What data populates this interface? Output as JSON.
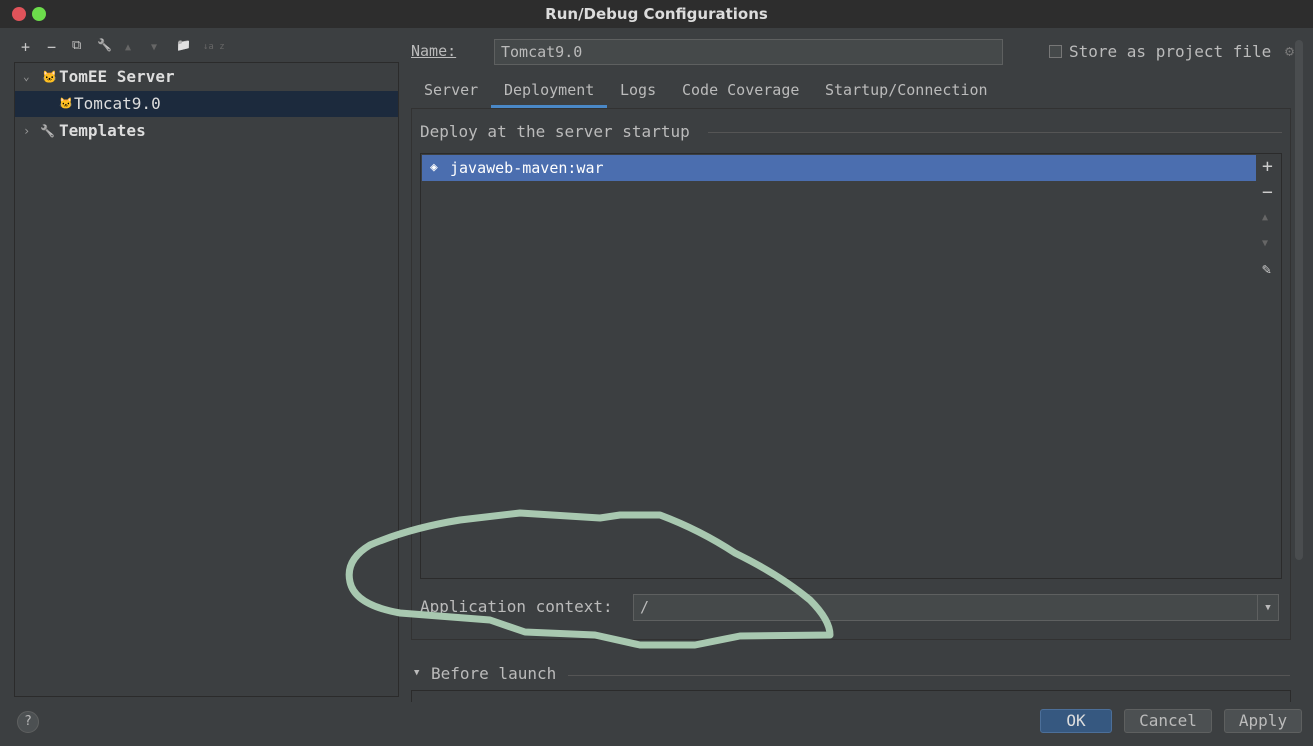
{
  "window": {
    "title": "Run/Debug Configurations"
  },
  "toolbar": {
    "add": "+",
    "remove": "−",
    "copy": "⧉",
    "edit": "🔧",
    "up": "▲",
    "down": "▼",
    "folder": "📁",
    "sort": "↓a z"
  },
  "tree": {
    "group": "TomEE Server",
    "item": "Tomcat9.0",
    "templates": "Templates"
  },
  "form": {
    "name_label": "Name:",
    "name_value": "Tomcat9.0",
    "store_label": "Store as project file"
  },
  "tabs": [
    "Server",
    "Deployment",
    "Logs",
    "Code Coverage",
    "Startup/Connection"
  ],
  "deployment": {
    "section": "Deploy at the server startup",
    "artifacts": [
      "javaweb-maven:war"
    ],
    "context_label": "Application context:",
    "context_value": "/"
  },
  "before_launch": {
    "label": "Before launch"
  },
  "buttons": {
    "help": "?",
    "ok": "OK",
    "cancel": "Cancel",
    "apply": "Apply"
  },
  "colors": {
    "selection": "#4b6eaf",
    "annotation": "#a8c8b0"
  }
}
